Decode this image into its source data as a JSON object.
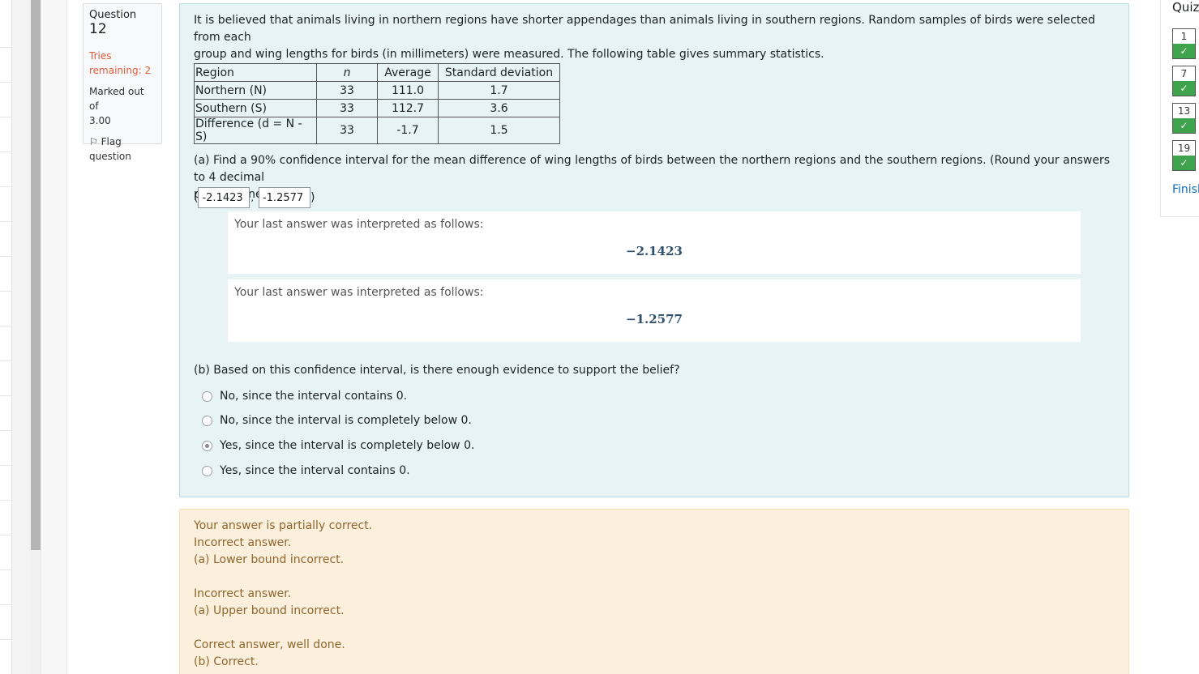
{
  "question_info": {
    "label": "Question",
    "number": "12",
    "tries_line1": "Tries",
    "tries_line2": "remaining: 2",
    "marked_line1": "Marked out of",
    "marked_line2": "3.00",
    "flag_line1": "Flag",
    "flag_line2": "question"
  },
  "question": {
    "text_line1": "It is believed that animals living in northern regions have shorter appendages than animals living in southern regions. Random samples of birds were selected from each",
    "text_line2": "group and wing lengths for birds (in millimeters) were measured. The following table gives summary statistics.",
    "table": {
      "headers": [
        "Region",
        "n",
        "Average",
        "Standard deviation"
      ],
      "rows": [
        [
          "Northern (N)",
          "33",
          "111.0",
          "1.7"
        ],
        [
          "Southern (S)",
          "33",
          "112.7",
          "3.6"
        ],
        [
          "Difference (d = N - S)",
          "33",
          "-1.7",
          "1.5"
        ]
      ]
    },
    "part_a_line1": "(a) Find a 90% confidence interval for the mean difference of wing lengths of birds between the northern regions and the southern regions. (Round your answers to 4 decimal",
    "part_a_line2": "places, if needed.)",
    "answer_lower": "-2.1423",
    "answer_upper": "-1.2577",
    "open_paren": "(",
    "comma": ",",
    "close_paren": ")",
    "interp_label": "Your last answer was interpreted as follows:",
    "interp_lower": "−2.1423",
    "interp_upper": "−1.2577",
    "part_b": "(b) Based on this confidence interval, is there enough evidence to support the belief?",
    "options": [
      {
        "label": "No, since the interval contains 0.",
        "selected": false
      },
      {
        "label": "No, since the interval is completely below 0.",
        "selected": false
      },
      {
        "label": "Yes, since the interval is completely below 0.",
        "selected": true
      },
      {
        "label": "Yes, since the interval contains 0.",
        "selected": false
      }
    ]
  },
  "feedback": {
    "line1": "Your answer is partially correct.",
    "line2": "Incorrect answer.",
    "line3": "(a) Lower bound incorrect.",
    "line4": "Incorrect answer.",
    "line5": "(a) Upper bound incorrect.",
    "line6": "Correct answer, well done.",
    "line7": "(b) Correct."
  },
  "nav": {
    "title": "Quiz",
    "buttons": [
      "1",
      "7",
      "13",
      "19"
    ],
    "check": "✓",
    "finish": "Finish"
  },
  "colors": {
    "question_bg": "#e7f3f5",
    "feedback_bg": "#fcefdc",
    "feedback_text": "#8e662e",
    "tries_text": "#e05a3a",
    "nav_check": "#3fa34d"
  }
}
